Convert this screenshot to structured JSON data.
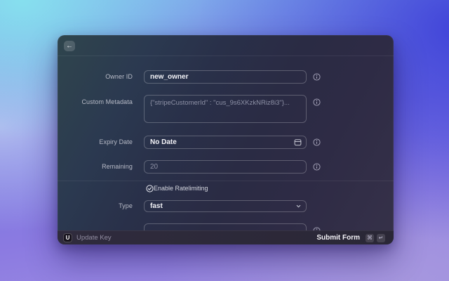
{
  "header": {
    "back_icon": "←"
  },
  "form": {
    "owner": {
      "label": "Owner ID",
      "value": "new_owner"
    },
    "metadata": {
      "label": "Custom Metadata",
      "placeholder": "{\"stripeCustomerId\" : \"cus_9s6XKzkNRiz8i3\"}..."
    },
    "expiry": {
      "label": "Expiry Date",
      "value": "No Date"
    },
    "remaining": {
      "label": "Remaining",
      "placeholder": "20"
    },
    "ratelimit_toggle": {
      "label": "Enable Ratelimiting",
      "checked": true
    },
    "ratelimit_type": {
      "label": "Type",
      "value": "fast"
    }
  },
  "footer": {
    "logo_letter": "U",
    "action_name": "Update Key",
    "submit_label": "Submit Form",
    "shortcuts": [
      "⌘",
      "↵"
    ]
  },
  "colors": {
    "bg_cyan": "#87e2ee",
    "bg_blue": "#3c3ed8",
    "bg_pink": "#c1cef2",
    "bg_purple": "#8b7ae1",
    "bg_lavender": "#a798de",
    "modal_teal": "#2f454d",
    "modal_indigo": "#2a2b44",
    "footer_bg": "#2b2839"
  }
}
